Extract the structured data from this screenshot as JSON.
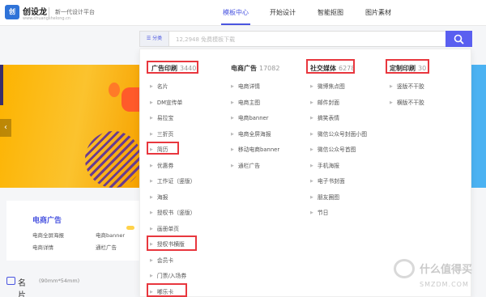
{
  "header": {
    "logo_mark": "创",
    "brand": "创设龙",
    "brand_sub": "www.chuangshelong.cn",
    "slogan": "新一代设计平台",
    "nav": [
      "模板中心",
      "开始设计",
      "智能抠图",
      "图片素材"
    ]
  },
  "search": {
    "category_label": "☰ 分类",
    "placeholder": "12,2948 免费模板下载"
  },
  "dropdown": {
    "columns": [
      {
        "title": "广告印刷",
        "count": "3440",
        "items": [
          "名片",
          "DM宣传单",
          "易拉宝",
          "三折页",
          "简历",
          "优惠券",
          "工作证（竖版）",
          "海报",
          "授权书（竖版）",
          "画册单页",
          "授权书横版",
          "会员卡",
          "门票/入场券",
          "嘟乐卡"
        ]
      },
      {
        "title": "电商广告",
        "count": "17082",
        "items": [
          "电商详情",
          "电商主图",
          "电商banner",
          "电商全屏海报",
          "移动电商banner",
          "通栏广告"
        ]
      },
      {
        "title": "社交媒体",
        "count": "6278",
        "items": [
          "微博焦点图",
          "邮件封面",
          "搞笑表情",
          "微信公众号封面小图",
          "微信公众号首图",
          "手机海报",
          "电子书封面",
          "朋友圈图",
          "节日"
        ]
      },
      {
        "title": "定制印刷",
        "count": "30",
        "items": [
          "竖版不干胶",
          "横版不干胶"
        ]
      }
    ]
  },
  "left_card": {
    "title": "电商广告",
    "links": [
      "电商全屏海报",
      "电商banner",
      "电商详情",
      "通栏广告"
    ]
  },
  "section": {
    "title": "名片",
    "sub": "(90mm*54mm)"
  },
  "banner": {
    "arrow": "‹"
  },
  "watermark": {
    "text": "什么值得买",
    "url": "SMZDM.COM"
  },
  "colors": {
    "accent": "#4a55e0",
    "highlight": "#e8373e",
    "search_button": "#5a5ff0"
  }
}
